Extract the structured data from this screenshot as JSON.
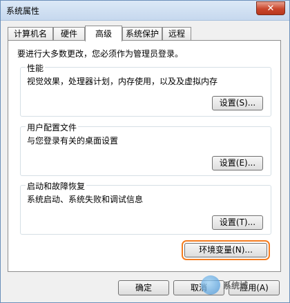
{
  "window": {
    "title": "系统属性",
    "close_glyph": "✕"
  },
  "tabs": [
    {
      "label": "计算机名",
      "active": false
    },
    {
      "label": "硬件",
      "active": false
    },
    {
      "label": "高级",
      "active": true
    },
    {
      "label": "系统保护",
      "active": false
    },
    {
      "label": "远程",
      "active": false
    }
  ],
  "advanced": {
    "admin_note": "要进行大多数更改，您必须作为管理员登录。",
    "performance": {
      "title": "性能",
      "description": "视觉效果，处理器计划，内存使用，以及及虚拟内存",
      "settings_button": "设置(S)..."
    },
    "user_profiles": {
      "title": "用户配置文件",
      "description": "与您登录有关的桌面设置",
      "settings_button": "设置(E)..."
    },
    "startup_recovery": {
      "title": "启动和故障恢复",
      "description": "系统启动、系统失败和调试信息",
      "settings_button": "设置(T)..."
    },
    "env_vars_button": "环境变量(N)..."
  },
  "footer": {
    "ok_button": "确定",
    "cancel_button": "取消",
    "apply_button": "应用(A)"
  },
  "watermark": {
    "text": "系统城"
  },
  "colors": {
    "highlight_outline": "#f47c20",
    "close_button": "#c9462c"
  }
}
